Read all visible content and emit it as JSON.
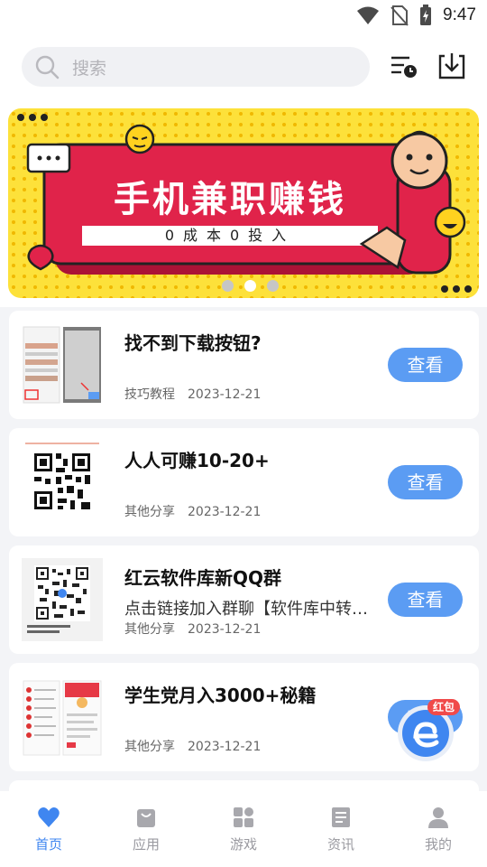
{
  "status_bar": {
    "time": "9:47"
  },
  "search": {
    "placeholder": "搜索"
  },
  "top_actions": {
    "history_icon": "history-list-icon",
    "download_icon": "download-icon"
  },
  "banner": {
    "title": "手机兼职赚钱",
    "subtitle": "0成本0投入",
    "slide_count": 3,
    "active_slide": 2,
    "colors": {
      "background": "#fde13a",
      "panel": "#e0234a"
    }
  },
  "list": [
    {
      "title": "找不到下载按钮?",
      "subtitle": "",
      "category": "技巧教程",
      "date": "2023-12-21",
      "button": "查看"
    },
    {
      "title": "人人可赚10-20+",
      "subtitle": "",
      "category": "其他分享",
      "date": "2023-12-21",
      "button": "查看"
    },
    {
      "title": "红云软件库新QQ群",
      "subtitle": "点击链接加入群聊【软件库中转…",
      "category": "其他分享",
      "date": "2023-12-21",
      "button": "查看"
    },
    {
      "title": "学生党月入3000+秘籍",
      "subtitle": "",
      "category": "其他分享",
      "date": "2023-12-21",
      "button": "查看"
    }
  ],
  "floating": {
    "badge": "红包"
  },
  "bottom_nav": [
    {
      "label": "首页",
      "icon": "heart-icon",
      "active": true
    },
    {
      "label": "应用",
      "icon": "bag-icon",
      "active": false
    },
    {
      "label": "游戏",
      "icon": "grid-icon",
      "active": false
    },
    {
      "label": "资讯",
      "icon": "news-icon",
      "active": false
    },
    {
      "label": "我的",
      "icon": "user-icon",
      "active": false
    }
  ],
  "colors": {
    "accent": "#3f86f0",
    "button": "#5b9cf3",
    "inactive": "#9a9aa0"
  }
}
